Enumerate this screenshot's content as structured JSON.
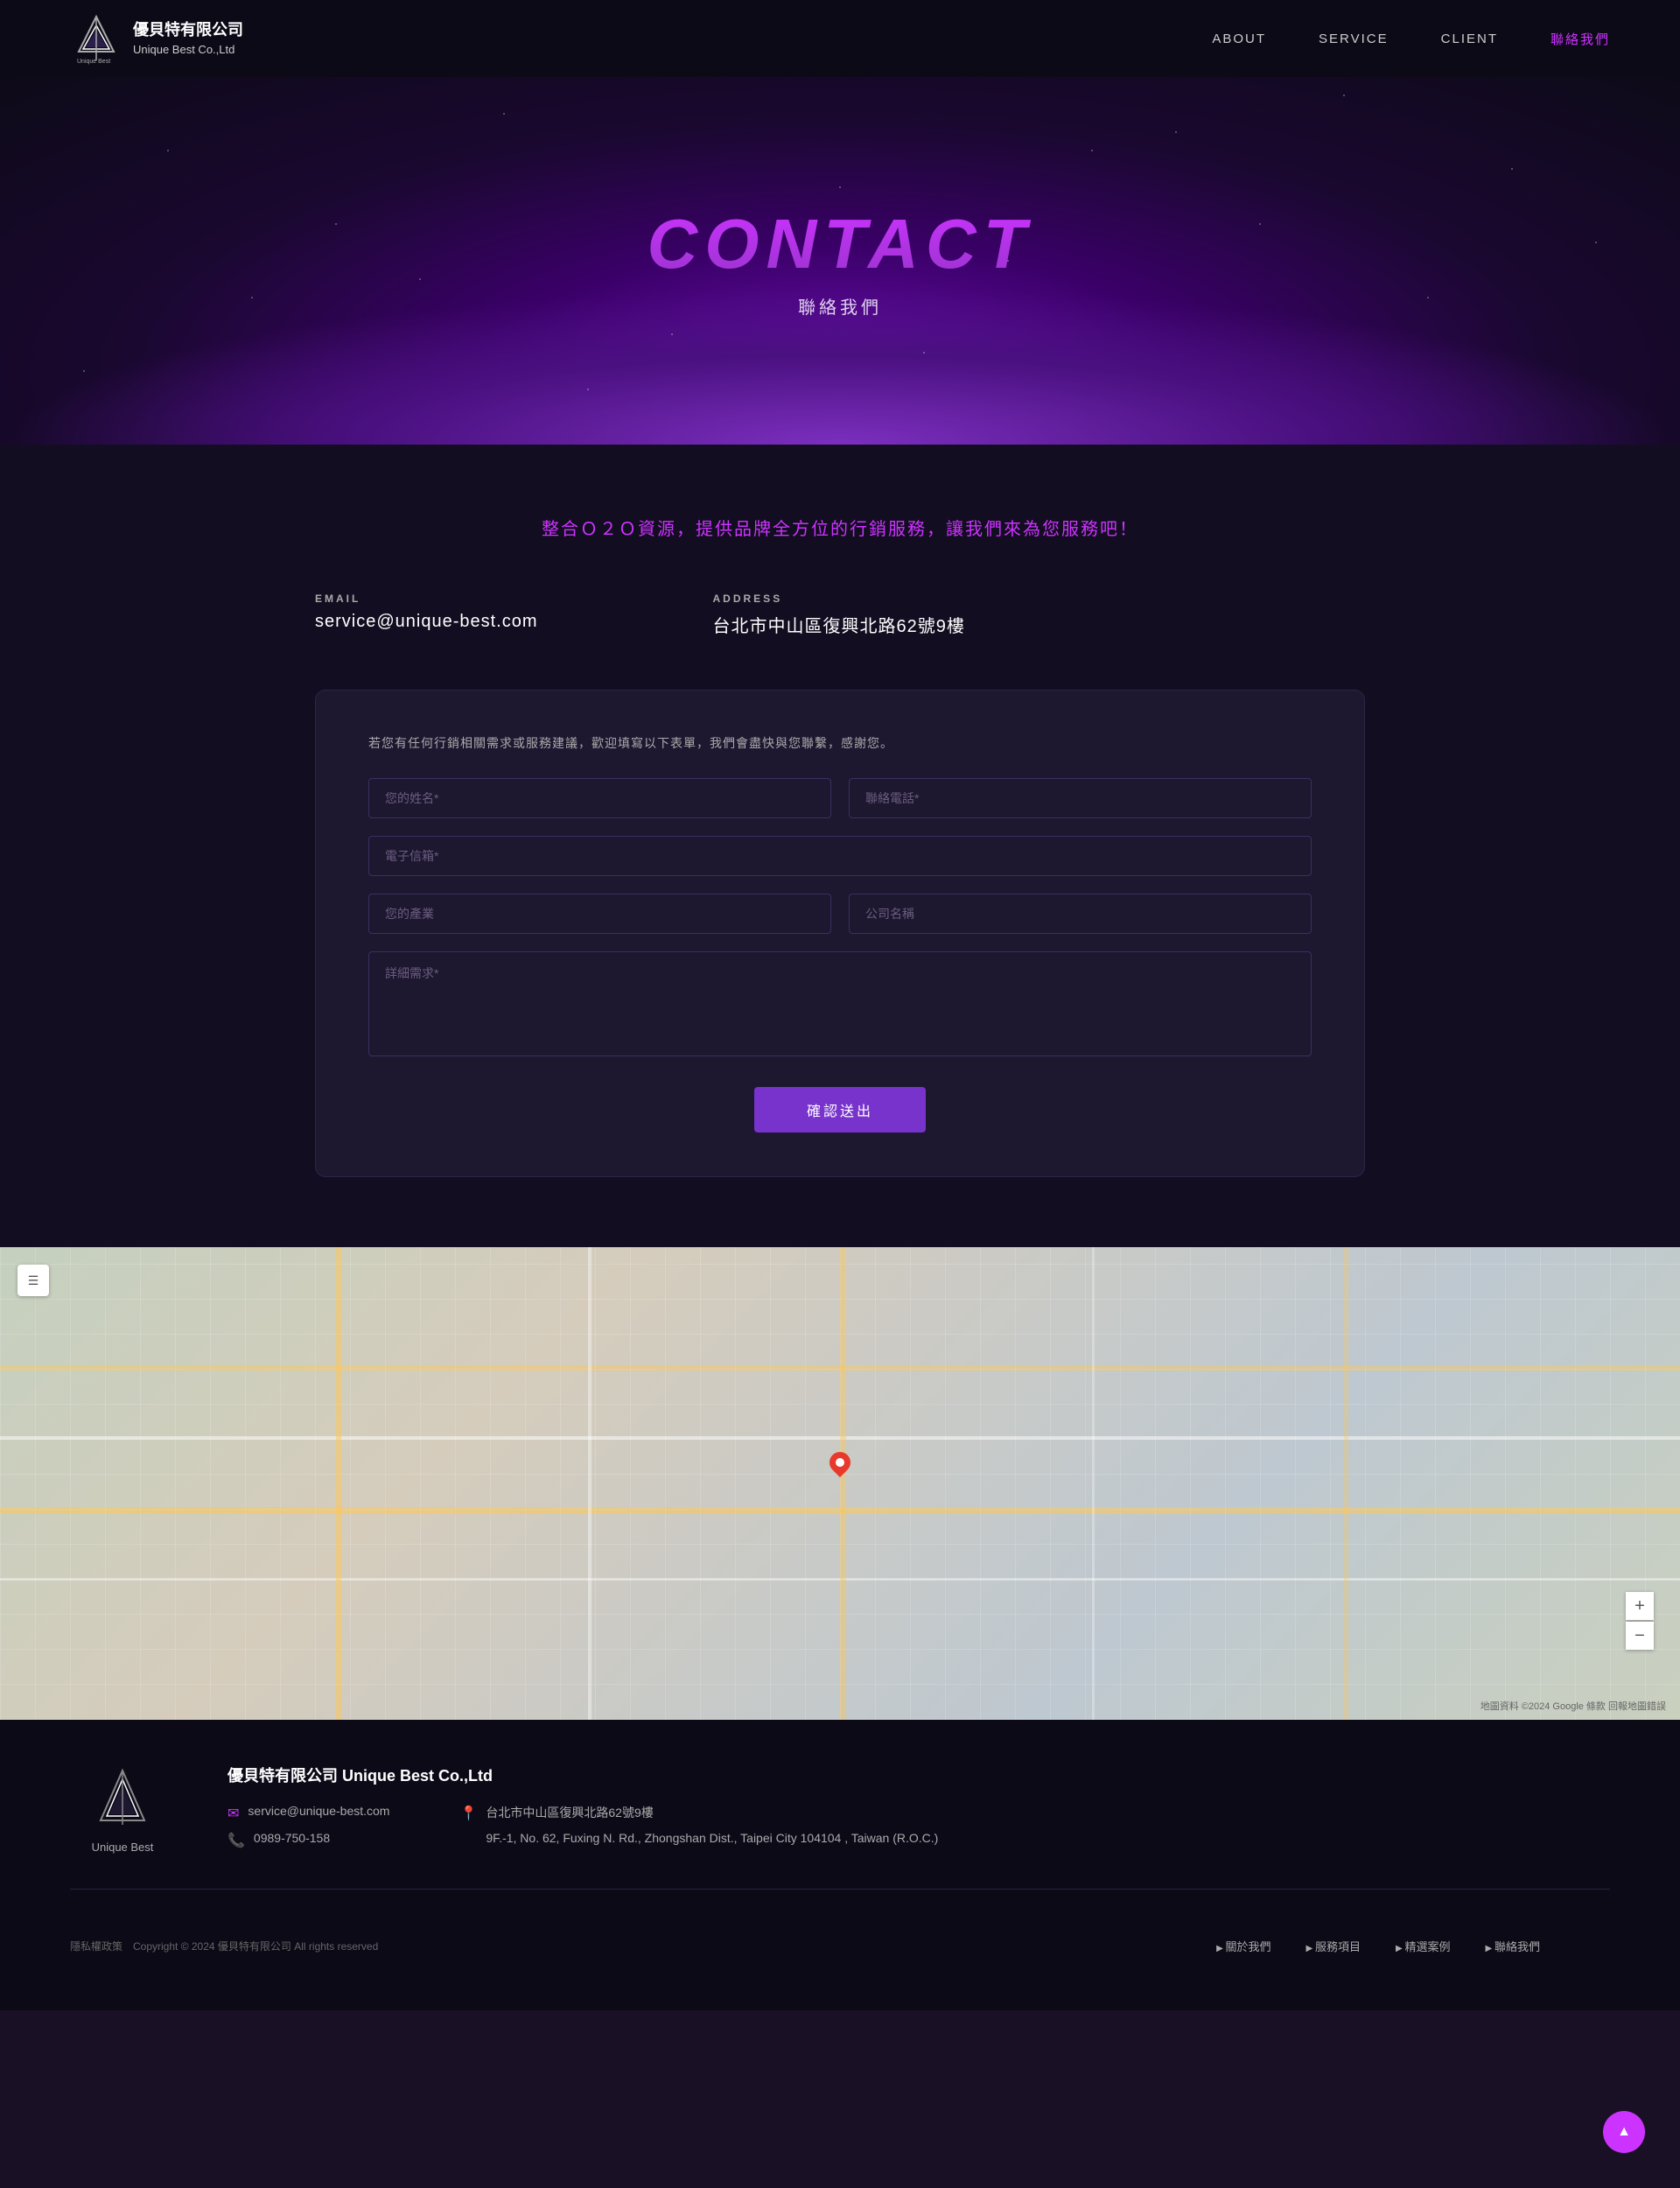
{
  "nav": {
    "logo_text_line1": "優貝特有限公司",
    "logo_text_line2": "Unique Best Co.,Ltd",
    "links": [
      {
        "label": "ABOUT",
        "href": "#",
        "active": false
      },
      {
        "label": "SERVICE",
        "href": "#",
        "active": false
      },
      {
        "label": "CLIENT",
        "href": "#",
        "active": false
      },
      {
        "label": "聯絡我們",
        "href": "#",
        "active": true
      }
    ]
  },
  "hero": {
    "title": "CONTACT",
    "subtitle": "聯絡我們"
  },
  "content": {
    "tagline": "整合Ｏ２Ｏ資源，提供品牌全方位的行銷服務，讓我們來為您服務吧！",
    "email_label": "EMAIL",
    "email_value": "service@unique-best.com",
    "address_label": "ADDRESS",
    "address_value": "台北市中山區復興北路62號9樓"
  },
  "form": {
    "hint": "若您有任何行銷相關需求或服務建議，歡迎填寫以下表單，我們會盡快與您聯繫，感謝您。",
    "field_name": "您的姓名*",
    "field_phone": "聯絡電話*",
    "field_email": "電子信箱*",
    "field_industry": "您的產業",
    "field_company": "公司名稱",
    "field_message": "詳細需求*",
    "submit_label": "確認送出"
  },
  "map": {
    "copyright": "地圖資料 ©2024 Google  條款  回報地圖錯誤"
  },
  "footer": {
    "logo_text": "Unique Best",
    "company": "優貝特有限公司 Unique Best Co.,Ltd",
    "email_icon": "✉",
    "email": "service@unique-best.com",
    "phone_icon": "📞",
    "phone": "0989-750-158",
    "address_icon": "📍",
    "address_tw": "台北市中山區復興北路62號9樓",
    "address_en": "9F.-1, No. 62, Fuxing N. Rd., Zhongshan Dist., Taipei City 104104 , Taiwan (R.O.C.)",
    "copyright": "隱私權政策　Copyright © 2024 優貝特有限公司 All rights reserved",
    "nav_links": [
      {
        "label": "關於我們"
      },
      {
        "label": "服務項目"
      },
      {
        "label": "精選案例"
      },
      {
        "label": "聯絡我們"
      }
    ]
  }
}
